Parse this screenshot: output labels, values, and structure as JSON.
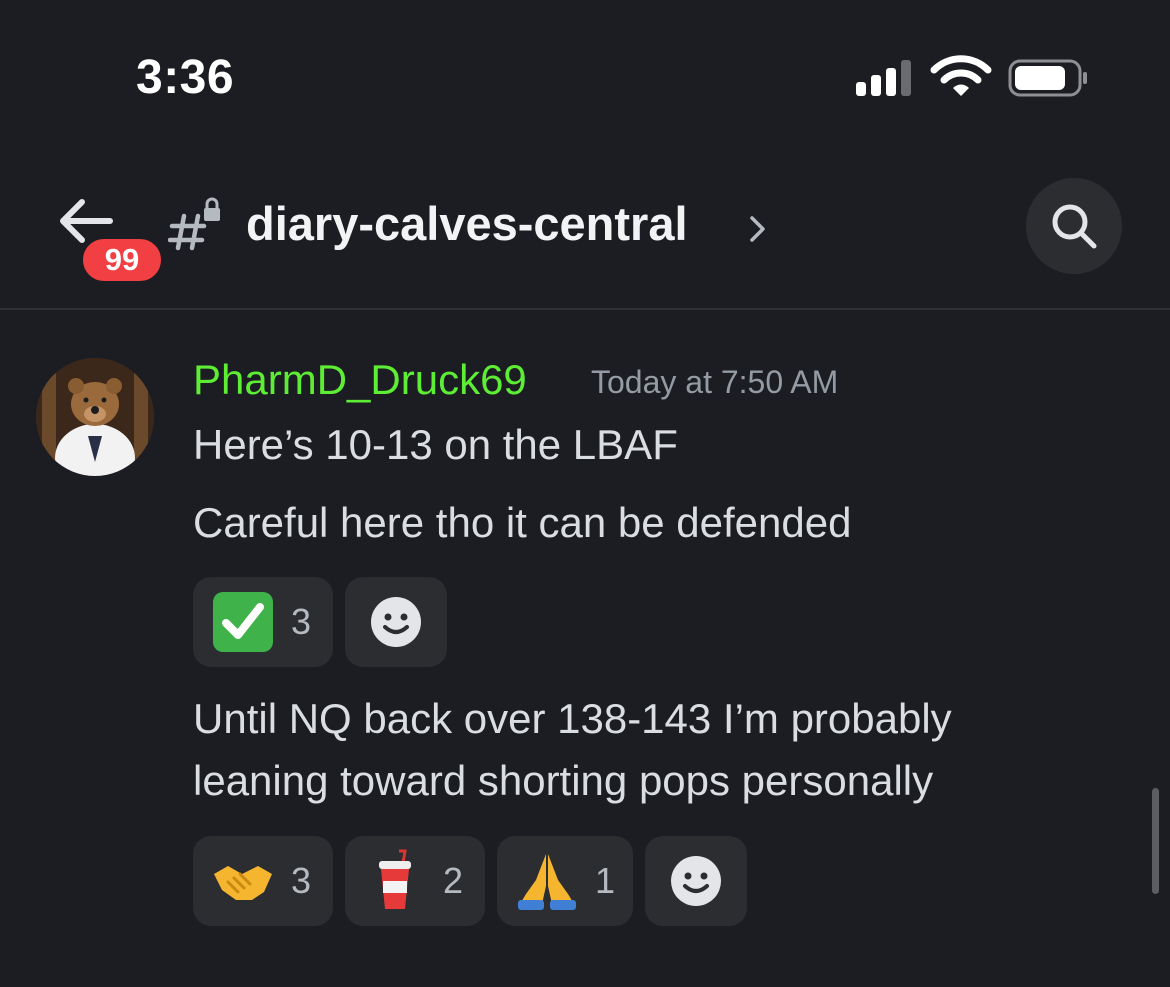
{
  "status_bar": {
    "time": "3:36"
  },
  "header": {
    "back_badge": "99",
    "channel_name": "diary-calves-central"
  },
  "message": {
    "author": "PharmD_Druck69",
    "author_color": "#5eed35",
    "timestamp": "Today at 7:50 AM",
    "lines": [
      "Here’s 10-13 on the LBAF",
      "Careful here tho it can be defended"
    ],
    "reactions_1": [
      {
        "emoji": "check-mark-button",
        "count": "3"
      }
    ],
    "lines_2": [
      "Until NQ back over 138-143 I’m probably",
      "leaning toward shorting pops personally"
    ],
    "reactions_2": [
      {
        "emoji": "handshake",
        "count": "3"
      },
      {
        "emoji": "cup-with-straw",
        "count": "2"
      },
      {
        "emoji": "folded-hands",
        "count": "1"
      }
    ]
  }
}
